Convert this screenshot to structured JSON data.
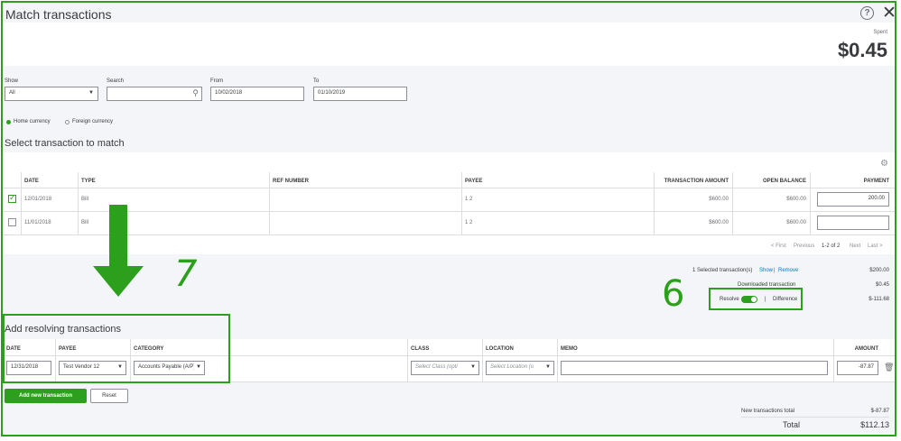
{
  "dialog": {
    "title": "Match transactions"
  },
  "summary": {
    "spent_label": "Spent",
    "spent_value": "$0.45"
  },
  "filters": {
    "show_label": "Show",
    "show_value": "All",
    "search_label": "Search",
    "search_value": "",
    "from_label": "From",
    "from_value": "10/02/2018",
    "to_label": "To",
    "to_value": "01/10/2019"
  },
  "currency": {
    "home": "Home currency",
    "foreign": "Foreign currency"
  },
  "match_section": {
    "title": "Select transaction to match",
    "columns": [
      "DATE",
      "TYPE",
      "REF NUMBER",
      "PAYEE",
      "TRANSACTION AMOUNT",
      "OPEN BALANCE",
      "PAYMENT"
    ],
    "rows": [
      {
        "checked": true,
        "date": "12/01/2018",
        "type": "Bill",
        "ref": "",
        "payee": "1 2",
        "amount": "$600.00",
        "open_balance": "$600.00",
        "payment": "200.00"
      },
      {
        "checked": false,
        "date": "11/01/2018",
        "type": "Bill",
        "ref": "",
        "payee": "1 2",
        "amount": "$600.00",
        "open_balance": "$600.00",
        "payment": ""
      }
    ],
    "pager": {
      "first": "< First",
      "previous": "Previous",
      "range": "1-2 of 2",
      "next": "Next",
      "last": "Last >"
    }
  },
  "totals": {
    "selected_text": "1 Selected transaction(s)",
    "show_link": "Show",
    "sep": "|",
    "remove_link": "Remove",
    "selected_value": "$200.00",
    "downloaded_label": "Downloaded transaction",
    "downloaded_value": "$0.45",
    "resolve_label": "Resolve",
    "difference_label": "Difference",
    "difference_value": "$-111.68"
  },
  "annotations": {
    "step6": "6",
    "step7": "7"
  },
  "resolve_section": {
    "title": "Add resolving transactions",
    "columns": {
      "date": "DATE",
      "payee": "PAYEE",
      "category": "CATEGORY",
      "class": "CLASS",
      "location": "LOCATION",
      "memo": "MEMO",
      "amount": "AMOUNT"
    },
    "row": {
      "date": "12/31/2018",
      "payee": "Test Vendor 12",
      "category": "Accounts Payable (A/P)",
      "class_placeholder": "Select Class (opti",
      "location_placeholder": "Select Location (o",
      "memo": "",
      "amount": "-87.87"
    },
    "add_button": "Add new transaction",
    "reset_button": "Reset"
  },
  "footer": {
    "new_total_label": "New transactions total",
    "new_total_value": "$-87.87",
    "total_label": "Total",
    "total_value": "$112.13"
  },
  "colors": {
    "brand_green": "#2ca01c",
    "link_blue": "#0077c5"
  }
}
